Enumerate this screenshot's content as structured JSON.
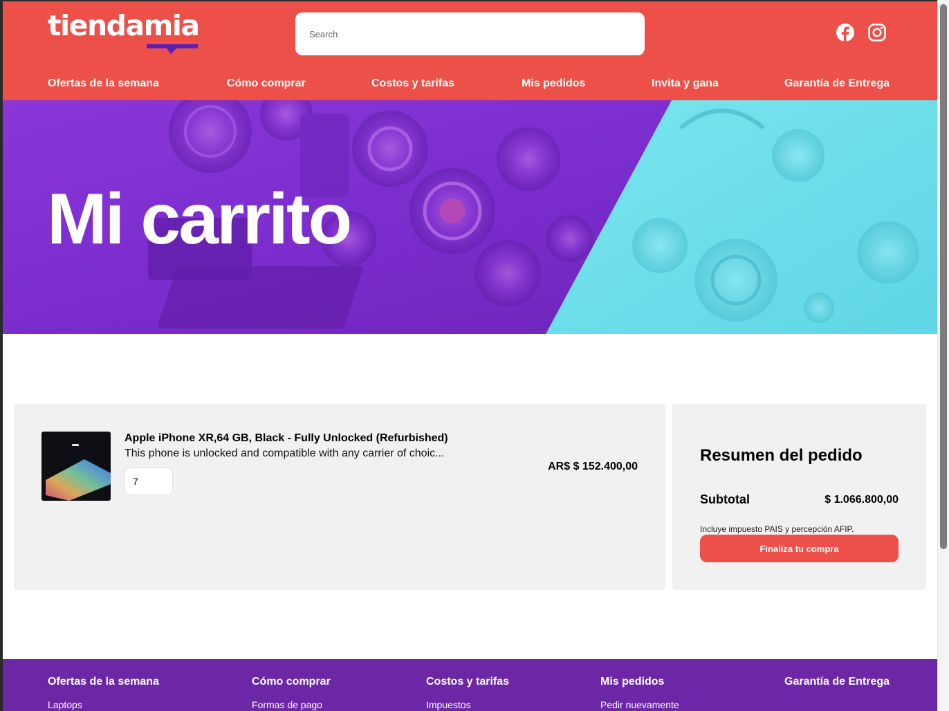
{
  "header": {
    "logo_text": "tiendamia",
    "search_placeholder": "Search",
    "social": [
      "facebook-icon",
      "instagram-icon"
    ]
  },
  "nav": {
    "items": [
      "Ofertas de la semana",
      "Cómo comprar",
      "Costos y tarifas",
      "Mis pedidos",
      "Invita y gana",
      "Garantía de Entrega"
    ]
  },
  "hero": {
    "title": "Mi carrito"
  },
  "cart": {
    "items": [
      {
        "title": "Apple iPhone XR,64 GB, Black - Fully Unlocked (Refurbished)",
        "description": "This phone is unlocked and compatible with any carrier of choic...",
        "quantity": "7",
        "price": "AR$ $ 152.400,00"
      }
    ]
  },
  "summary": {
    "title": "Resumen del pedido",
    "subtotal_label": "Subtotal",
    "subtotal_value": "$ 1.066.800,00",
    "tax_note": "Incluye impuesto PAIS y percepción AFIP.",
    "checkout_label": "Finaliza tu compra"
  },
  "footer": {
    "columns": [
      {
        "title": "Ofertas de la semana",
        "link": "Laptops"
      },
      {
        "title": "Cómo comprar",
        "link": "Formas de pago"
      },
      {
        "title": "Costos y tarifas",
        "link": "Impuestos"
      },
      {
        "title": "Mis pedidos",
        "link": "Pedir nuevamente"
      },
      {
        "title": "Garantía de Entrega",
        "link": ""
      }
    ]
  },
  "colors": {
    "brand_red": "#ec5048",
    "brand_purple": "#6b27a6",
    "hero_purple": "#7a2fd0",
    "hero_cyan": "#6fe1ec",
    "panel_gray": "#f1f1f1"
  }
}
